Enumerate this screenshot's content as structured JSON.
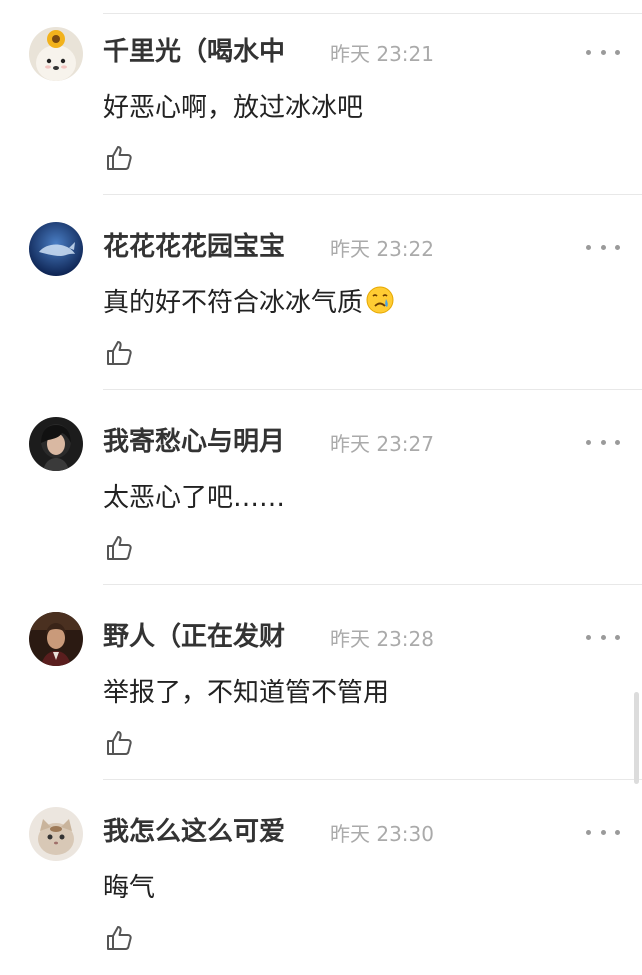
{
  "comments": [
    {
      "username": "千里光（喝水中",
      "time": "昨天 23:21",
      "text": "好恶心啊，放过冰冰吧",
      "avatar_icon": "dog-with-sunflower-avatar"
    },
    {
      "username": "花花花花园宝宝",
      "time": "昨天 23:22",
      "text": "真的好不符合冰冰气质",
      "emoji": "crying-face-emoji",
      "avatar_icon": "blue-whale-avatar"
    },
    {
      "username": "我寄愁心与明月",
      "time": "昨天 23:27",
      "text": "太恶心了吧……",
      "avatar_icon": "girl-portrait-avatar"
    },
    {
      "username": "野人（正在发财",
      "time": "昨天 23:28",
      "text": "举报了，不知道管不管用",
      "avatar_icon": "man-portrait-avatar"
    },
    {
      "username": "我怎么这么可爱",
      "time": "昨天 23:30",
      "text": "晦气",
      "avatar_icon": "cat-avatar"
    }
  ],
  "colors": {
    "username": "#333333",
    "time": "#aaaaaa",
    "text": "#222222",
    "divider": "#e8e8e8"
  },
  "icons": {
    "like": "thumbs-up-icon",
    "more": "more-dots-icon"
  }
}
